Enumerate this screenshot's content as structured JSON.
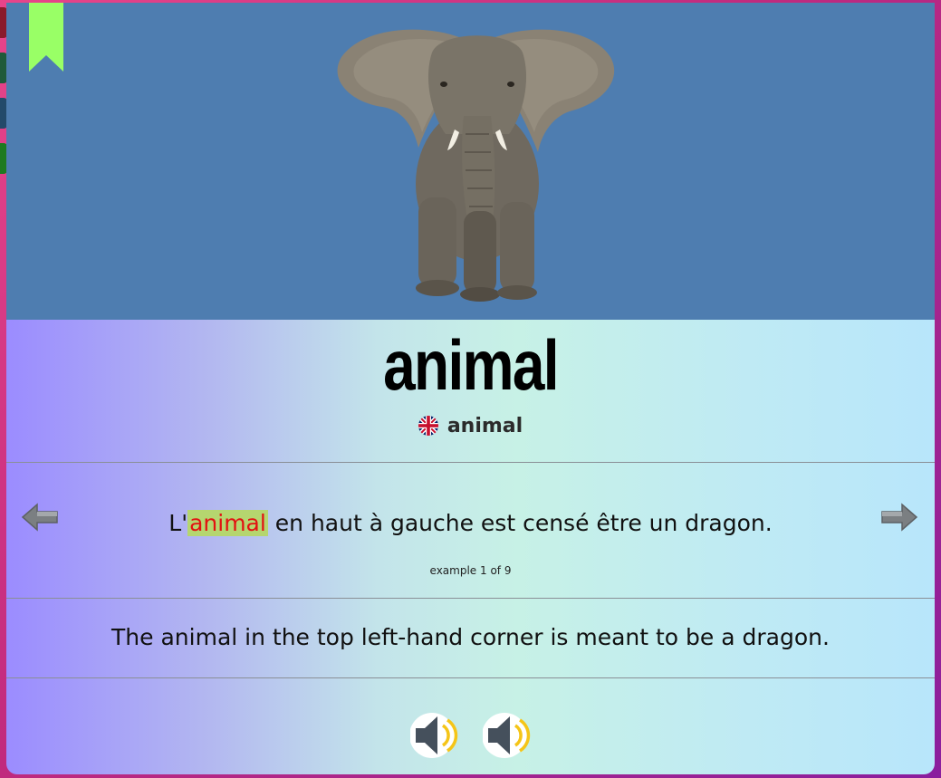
{
  "flashcard": {
    "word": "animal",
    "translation": "animal",
    "example": {
      "before": "L'",
      "highlight": "animal",
      "after": " en haut à gauche est censé être un dragon.",
      "counter": "example 1 of 9"
    },
    "english_sentence": "The animal in the top left-hand corner is meant to be a dragon."
  },
  "icons": {
    "bookmark": "bookmark-icon",
    "flag": "uk-flag-icon",
    "prev": "arrow-left-icon",
    "next": "arrow-right-icon",
    "audio": "speaker-icon"
  },
  "colors": {
    "image_background": "#4e7db0",
    "bookmark": "#99ff66",
    "highlight_background": "#b5d66f",
    "highlight_text": "#e31111",
    "audio_speaker": "#45505c",
    "audio_waves": "#f5c518"
  }
}
